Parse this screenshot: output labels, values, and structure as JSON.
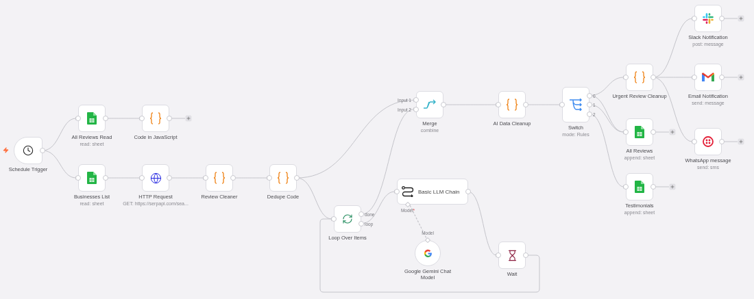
{
  "workflow": {
    "nodes": [
      {
        "kind": "schedule",
        "label": "Schedule Trigger"
      },
      {
        "kind": "sheets",
        "label": "All Reviews Read",
        "subtitle": "read: sheet"
      },
      {
        "kind": "code",
        "label": "Code in JavaScript"
      },
      {
        "kind": "sheets",
        "label": "Businesses List",
        "subtitle": "read: sheet"
      },
      {
        "kind": "http",
        "label": "HTTP Request",
        "subtitle": "GET: https://serpapi.com/sea..."
      },
      {
        "kind": "code",
        "label": "Review Cleaner"
      },
      {
        "kind": "code",
        "label": "Dedupe Code"
      },
      {
        "kind": "merge",
        "label": "Merge",
        "subtitle": "combine",
        "inputs": [
          "Input 1",
          "Input 2"
        ]
      },
      {
        "kind": "code",
        "label": "AI Data Cleanup"
      },
      {
        "kind": "switch",
        "label": "Switch",
        "subtitle": "mode: Rules",
        "outputs": [
          "0",
          "1",
          "2"
        ]
      },
      {
        "kind": "loop",
        "label": "Loop Over Items",
        "outputs": [
          "done",
          "loop"
        ]
      },
      {
        "kind": "llm",
        "label": "Basic LLM Chain",
        "model_port": {
          "label": "Model",
          "mark": "*"
        }
      },
      {
        "kind": "gemini",
        "label": "Google Gemini Chat Model",
        "model_port": {
          "label": "Model"
        }
      },
      {
        "kind": "wait",
        "label": "Wait"
      },
      {
        "kind": "code",
        "label": "Urgent Review Cleanup"
      },
      {
        "kind": "sheets",
        "label": "All Reviews",
        "subtitle": "append: sheet"
      },
      {
        "kind": "sheets",
        "label": "Testimonials",
        "subtitle": "append: sheet"
      },
      {
        "kind": "slack",
        "label": "Slack Notification",
        "subtitle": "post: message"
      },
      {
        "kind": "gmail",
        "label": "Email Notification",
        "subtitle": "send: message"
      },
      {
        "kind": "twilio",
        "label": "WhatsApp message",
        "subtitle": "send: sms"
      }
    ]
  }
}
